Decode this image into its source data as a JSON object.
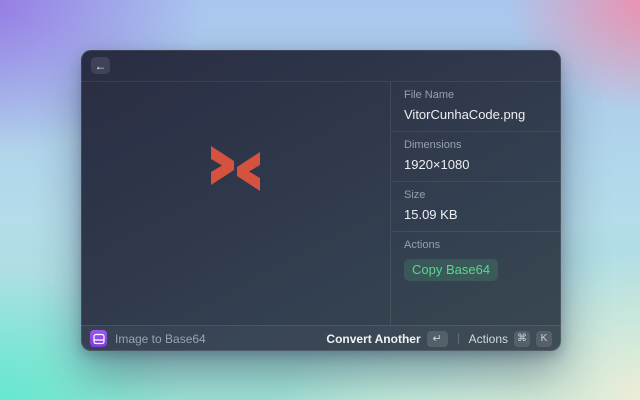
{
  "window": {
    "header": {
      "back_icon": "←"
    },
    "details": [
      {
        "label": "File Name",
        "value": "VitorCunhaCode.png"
      },
      {
        "label": "Dimensions",
        "value": "1920×1080"
      },
      {
        "label": "Size",
        "value": "15.09 KB"
      }
    ],
    "actions_section": {
      "label": "Actions",
      "button": "Copy Base64"
    },
    "footer": {
      "title": "Image to Base64",
      "primary_action_label": "Convert Another",
      "primary_action_key": "↵",
      "actions_label": "Actions",
      "key_cmd": "⌘",
      "key_k": "K"
    }
  },
  "colors": {
    "logo_red": "#d5523f",
    "accent_green": "#5cd58f",
    "icon_purple": "#8b46e4"
  }
}
